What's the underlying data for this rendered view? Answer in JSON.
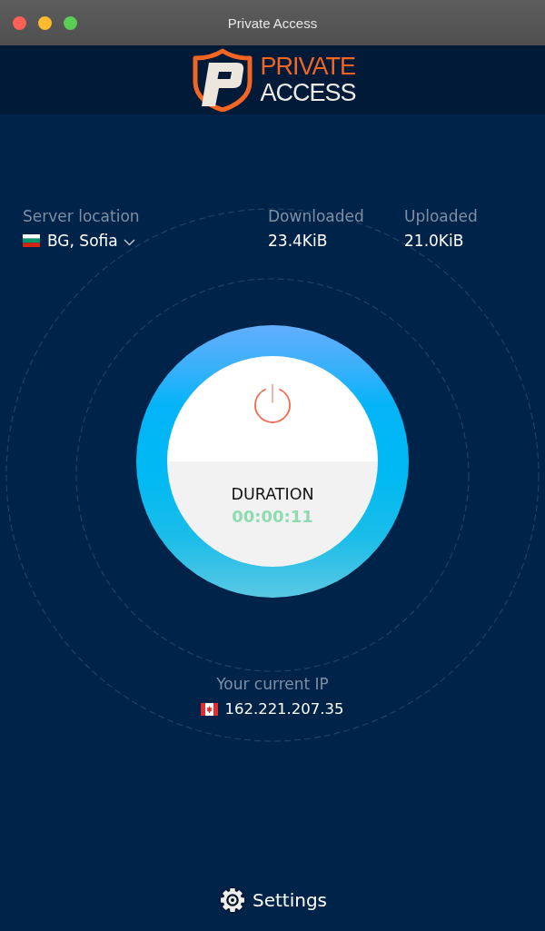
{
  "window": {
    "title": "Private Access"
  },
  "logo": {
    "lines": [
      "PRIVATE",
      "ACCESS"
    ]
  },
  "server_location": {
    "label": "Server location",
    "value": "BG, Sofia"
  },
  "traffic": [
    {
      "label": "Downloaded",
      "value": "23.4KiB"
    },
    {
      "label": "Uploaded",
      "value": "21.0KiB"
    }
  ],
  "connection": {
    "label": "DURATION",
    "duration": "00:00:11"
  },
  "current_ip": {
    "label": "Your current IP",
    "value": "162.221.207.35"
  },
  "settings": {
    "label": "Settings"
  }
}
